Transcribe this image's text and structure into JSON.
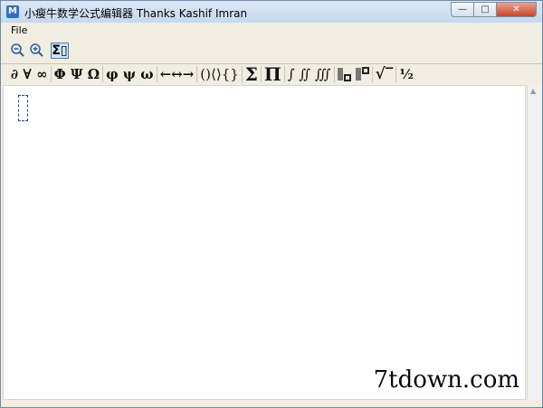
{
  "window": {
    "title": "小瘦牛数学公式编辑器 Thanks Kashif Imran",
    "app_icon": "M",
    "minimize_glyph": "—",
    "maximize_glyph": "□",
    "close_glyph": "✕"
  },
  "menu": {
    "file": "File"
  },
  "toolbar": {
    "zoom_out": "−",
    "zoom_in": "+",
    "formula_mode": "Σ▯"
  },
  "symbols": {
    "group1": "∂ ∀ ∞",
    "group2": "Φ Ψ Ω",
    "group3": "φ ψ ω",
    "group4": "←↔→",
    "group5": "()⟨⟩{}",
    "sum": "Σ",
    "product": "Π",
    "integrals": "∫ ∬ ∭",
    "sqrt": "√‾",
    "fraction": "½"
  },
  "watermark": "7tdown.com"
}
